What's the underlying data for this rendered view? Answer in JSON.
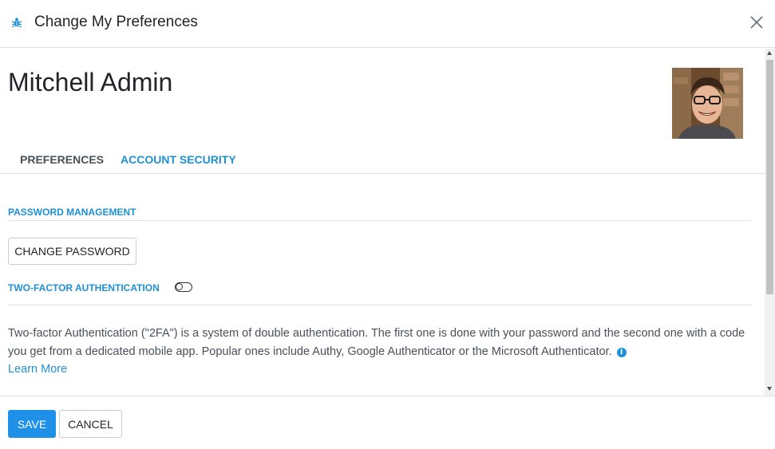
{
  "dialog": {
    "title": "Change My Preferences"
  },
  "user": {
    "name": "Mitchell Admin"
  },
  "tabs": [
    {
      "label": "PREFERENCES",
      "active": false
    },
    {
      "label": "ACCOUNT SECURITY",
      "active": true
    }
  ],
  "security": {
    "password_section_title": "PASSWORD MANAGEMENT",
    "change_password_label": "CHANGE PASSWORD",
    "two_factor_title": "TWO-FACTOR AUTHENTICATION",
    "two_factor_enabled": false,
    "description": "Two-factor Authentication (\"2FA\") is a system of double authentication. The first one is done with your password and the second one with a code you get from a dedicated mobile app. Popular ones include Authy, Google Authenticator or the Microsoft Authenticator.",
    "learn_more_label": "Learn More"
  },
  "footer": {
    "save_label": "SAVE",
    "cancel_label": "CANCEL"
  },
  "colors": {
    "accent": "#1e90d5",
    "primary_button": "#1e90e8"
  },
  "icons": {
    "header": "bug-icon",
    "close": "close-icon",
    "info": "info-icon"
  }
}
